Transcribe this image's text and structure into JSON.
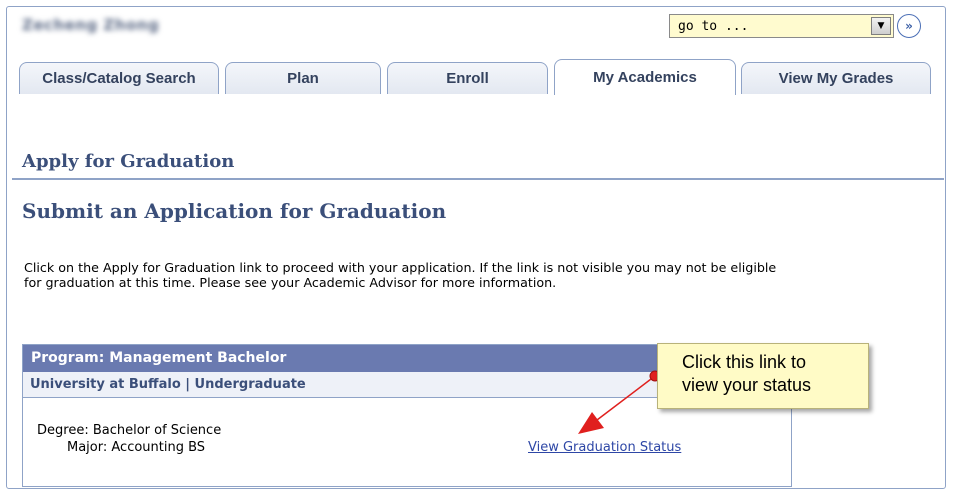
{
  "header": {
    "user_name": "Zecheng Zhong",
    "goto": {
      "value": "go to ...",
      "dropdown_icon": "chevron-down-icon",
      "go_icon": "double-chevron-right-icon"
    }
  },
  "tabs": [
    {
      "label": "Class/Catalog Search",
      "active": false
    },
    {
      "label": "Plan",
      "active": false
    },
    {
      "label": "Enroll",
      "active": false
    },
    {
      "label": "My Academics",
      "active": true
    },
    {
      "label": "View My Grades",
      "active": false
    }
  ],
  "page": {
    "title": "Apply for Graduation",
    "subtitle": "Submit an Application for Graduation",
    "instructions": "Click on the Apply for Graduation link to proceed with your application. If the link is not visible you may not be eligible for graduation at this time. Please see your Academic Advisor for more information."
  },
  "program": {
    "header": "Program: Management Bachelor",
    "institution": "University at Buffalo | Undergraduate",
    "degree": "Degree: Bachelor of Science",
    "major": "Major: Accounting BS",
    "status_link": "View Graduation Status"
  },
  "callout": {
    "line1": "Click this link to",
    "line2": "view your status"
  },
  "colors": {
    "accent": "#3b4f7a",
    "program_header_bg": "#6a7ab0",
    "link": "#2e47a6",
    "callout_bg": "#fffbc6",
    "arrow": "#e0201e"
  }
}
